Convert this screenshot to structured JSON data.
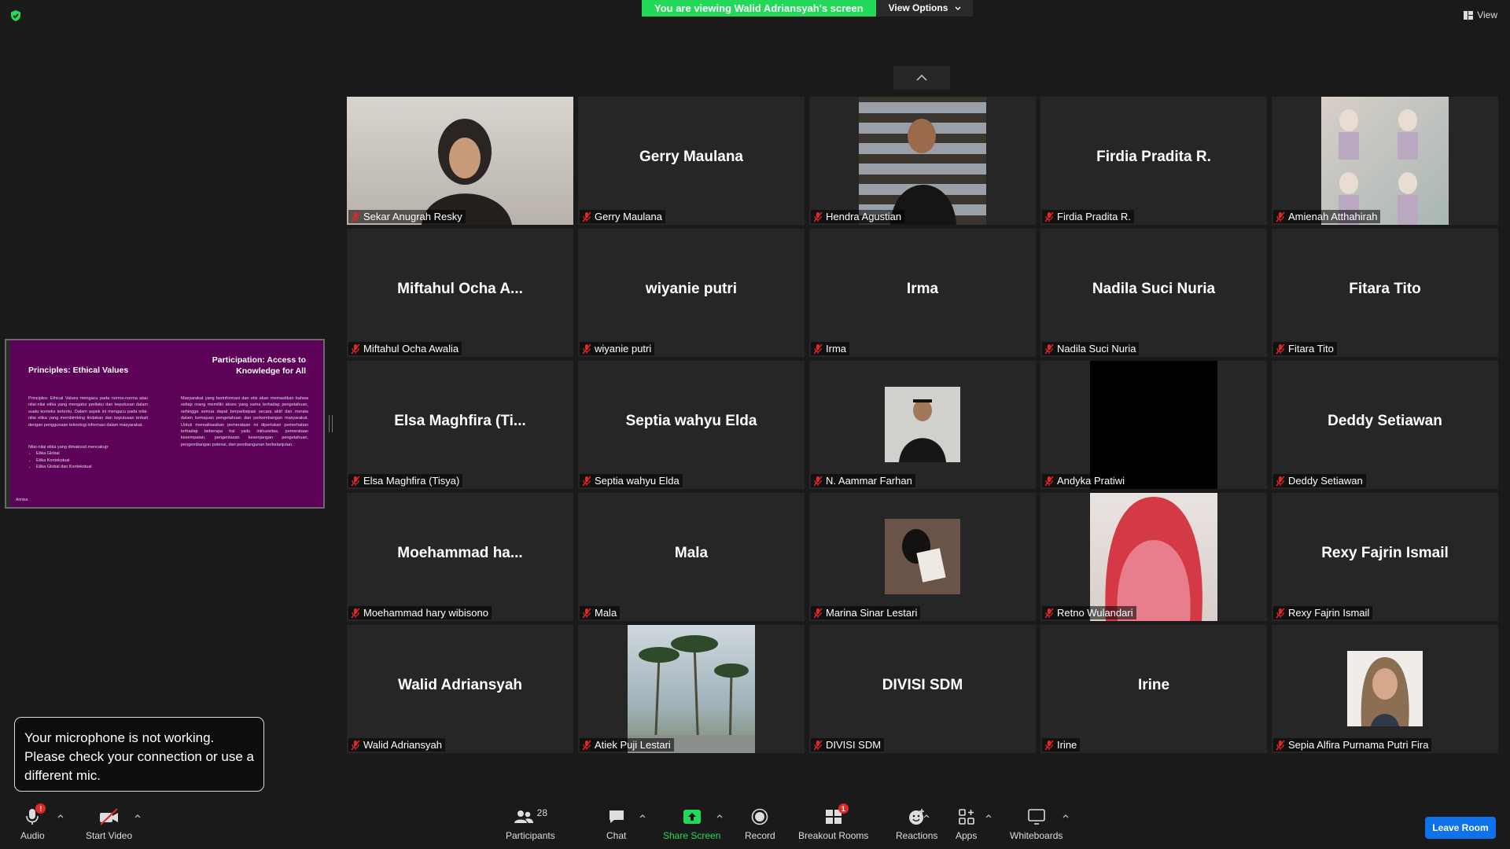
{
  "banner": {
    "viewing": "You are viewing Walid Adriansyah's screen",
    "view_options": "View Options"
  },
  "top": {
    "view_label": "View"
  },
  "shared_slide": {
    "left_title": "Principles: Ethical Values",
    "right_title": "Participation: Access to Knowledge for All",
    "left_body": "Principles: Ethical Values mengacu pada norma-norma atau nilai-nilai etika yang mengatur perilaku dan keputusan dalam suatu konteks tertentu. Dalam aspek ini mengacu pada nilai-nilai etika yang membimbing tindakan dan keputusan terkait dengan penggunaan teknologi informasi dalam masyarakat.",
    "left_list_intro": "Nilai-nilai etika yang dimaksud mencakup:",
    "left_list": [
      "Etika Global",
      "Etika Kontekstual",
      "Etika Global dan Kontekstual"
    ],
    "right_body": "Masyarakat yang berinformasi dan etis akan memastikan bahwa setiap orang memiliki akses yang sama terhadap pengetahuan, sehingga semua dapat berpartisipasi secara aktif dan merata dalam kemajuan pengetahuan dan perkembangan masyarakat. Untuk merealisasikan pemerataan ini diperlukan pemerhatian terhadap beberapa hal yaitu inklusivitas, pemerataan kesempatan, pengentasan kesenjangan pengetahuan, pengembangan potensi, dan pembangunan berkelanjutan.",
    "footer": "Annisa"
  },
  "participants": [
    {
      "big": "",
      "label": "Sekar Anugrah Resky",
      "video": "sekar"
    },
    {
      "big": "Gerry Maulana",
      "label": "Gerry Maulana"
    },
    {
      "big": "",
      "label": "Hendra Agustian",
      "video": "hendra"
    },
    {
      "big": "Firdia Pradita R.",
      "label": "Firdia Pradita R."
    },
    {
      "big": "",
      "label": "Amienah Atthahirah",
      "video": "amienah"
    },
    {
      "big": "Miftahul  Ocha  A...",
      "label": "Miftahul Ocha Awalia"
    },
    {
      "big": "wiyanie putri",
      "label": "wiyanie putri"
    },
    {
      "big": "Irma",
      "label": "Irma"
    },
    {
      "big": "Nadila Suci Nuria",
      "label": "Nadila Suci Nuria"
    },
    {
      "big": "Fitara Tito",
      "label": "Fitara Tito"
    },
    {
      "big": "Elsa  Maghfira  (Ti...",
      "label": "Elsa Maghfira (Tisya)"
    },
    {
      "big": "Septia wahyu Elda",
      "label": "Septia wahyu Elda"
    },
    {
      "big": "",
      "label": "N. Aammar Farhan",
      "video": "aammar"
    },
    {
      "big": "",
      "label": "Andyka Pratiwi",
      "video": "andyka"
    },
    {
      "big": "Deddy Setiawan",
      "label": "Deddy Setiawan"
    },
    {
      "big": "Moehammad  ha...",
      "label": "Moehammad hary wibisono"
    },
    {
      "big": "Mala",
      "label": "Mala"
    },
    {
      "big": "",
      "label": "Marina Sinar Lestari",
      "video": "marina"
    },
    {
      "big": "",
      "label": "Retno Wulandari",
      "video": "retno"
    },
    {
      "big": "Rexy Fajrin Ismail",
      "label": "Rexy Fajrin Ismail"
    },
    {
      "big": "Walid Adriansyah",
      "label": "Walid Adriansyah"
    },
    {
      "big": "",
      "label": "Atiek Puji Lestari",
      "video": "atiek"
    },
    {
      "big": "DIVISI SDM",
      "label": "DIVISI SDM"
    },
    {
      "big": "Irine",
      "label": "Irine"
    },
    {
      "big": "",
      "label": "Sepia Alfira Purnama Putri Fira",
      "video": "sepia"
    }
  ],
  "toast": {
    "message": "Your microphone is not working. Please check your connection or use a different mic."
  },
  "toolbar": {
    "audio": "Audio",
    "audio_badge": "!",
    "start_video": "Start Video",
    "participants": "Participants",
    "participants_count": "28",
    "chat": "Chat",
    "share_screen": "Share Screen",
    "record": "Record",
    "breakout_rooms": "Breakout Rooms",
    "breakout_badge": "1",
    "reactions": "Reactions",
    "apps": "Apps",
    "whiteboards": "Whiteboards",
    "leave_room": "Leave Room"
  },
  "colors": {
    "share_green": "#23d959",
    "leave_blue": "#0e72ed",
    "mic_red": "#e02828",
    "slide_purple": "#5c0058"
  }
}
